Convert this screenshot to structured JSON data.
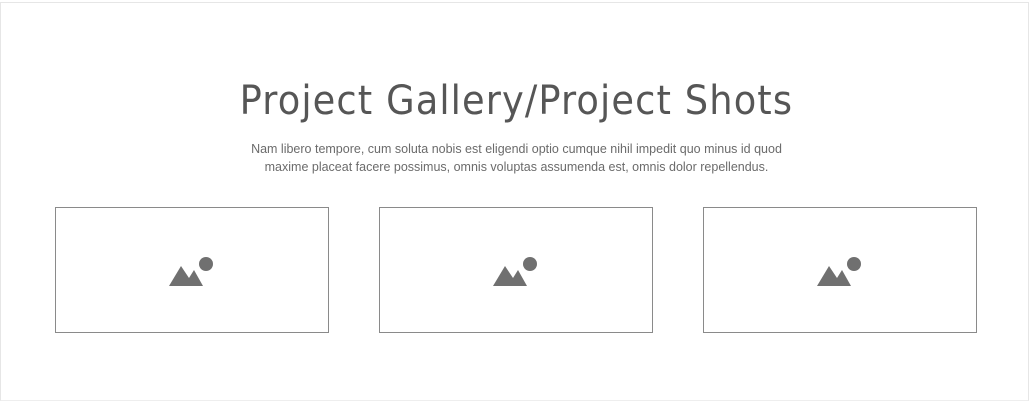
{
  "section": {
    "title": "Project Gallery/Project Shots",
    "description_line_1": "Nam libero tempore, cum soluta nobis est eligendi optio cumque nihil impedit quo minus id quod",
    "description_line_2": "maxime placeat facere possimus, omnis voluptas assumenda est, omnis dolor repellendus."
  },
  "gallery": {
    "items": [
      {
        "icon": "image-placeholder-icon"
      },
      {
        "icon": "image-placeholder-icon"
      },
      {
        "icon": "image-placeholder-icon"
      }
    ]
  },
  "colors": {
    "title": "#565656",
    "text": "#6b6b6b",
    "card_border": "#8a8a8a",
    "icon": "#707070"
  }
}
